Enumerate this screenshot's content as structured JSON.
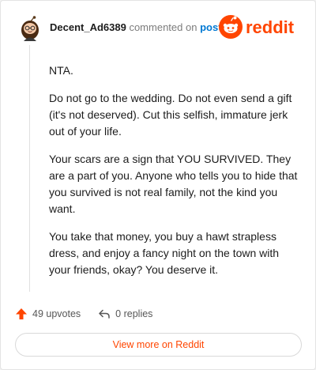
{
  "header": {
    "username": "Decent_Ad6389",
    "connector": "commented on",
    "post_link": "post",
    "logo_text": "reddit",
    "brand_color": "#ff4500"
  },
  "comment": {
    "paragraphs": [
      "NTA.",
      "Do not go to the wedding. Do not even send a gift (it's not deserved). Cut this selfish, immature jerk out of your life.",
      "Your scars are a sign that YOU SURVIVED. They are a part of you. Anyone who tells you to hide that you survived is not real family, not the kind you want.",
      "You take that money, you buy a hawt strapless dress, and enjoy a fancy night on the town with your friends, okay? You deserve it."
    ]
  },
  "actions": {
    "upvotes_label": "49 upvotes",
    "upvote_icon": "upvote-arrow-icon",
    "upvote_color": "#ff4500",
    "replies_label": "0 replies",
    "reply_icon": "reply-arrow-icon"
  },
  "footer": {
    "view_more_label": "View more on Reddit"
  }
}
